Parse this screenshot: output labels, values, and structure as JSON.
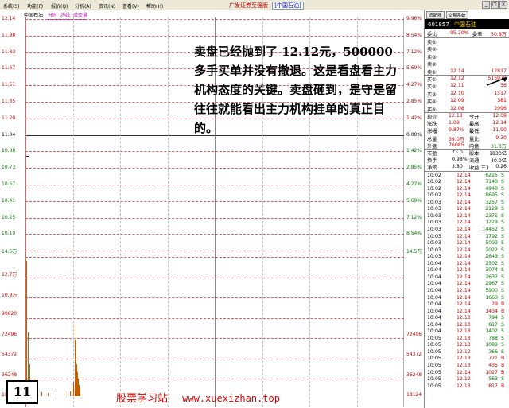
{
  "menubar": {
    "items": [
      "系统(S)",
      "功能(F)",
      "报价(Q)",
      "分析(A)",
      "资讯(N)",
      "查看(V)",
      "帮助(H)"
    ],
    "title": "广发证券至强版",
    "subtitle": "[中国石油]"
  },
  "chart": {
    "stock_name": "中国石油",
    "tab_time": "分时",
    "tab_avg": "均线",
    "tab_vol": "成交量",
    "price_labels": [
      "12.14",
      "11.98",
      "11.83",
      "11.67",
      "11.51",
      "11.35",
      "11.20",
      "11.04",
      "10.88",
      "10.73",
      "10.57",
      "10.41",
      "10.25",
      "10.10",
      "14.5万"
    ],
    "pct_labels": [
      "9.96%",
      "8.54%",
      "7.12%",
      "5.69%",
      "4.27%",
      "2.85%",
      "1.42%",
      "0.00%",
      "1.42%",
      "2.85%",
      "4.27%",
      "5.69%",
      "7.12%",
      "8.54%",
      "14.5万"
    ],
    "vol_labels": [
      "12.7万",
      "10.9万",
      "90620",
      "72496",
      "54372",
      "36248",
      "18124"
    ],
    "annotation": "卖盘已经抛到了 12.12元，500000 多手买单并没有撤退。这是看盘看主力机构态度的关键。卖盘砸到，是守是留往往就能看出主力机构挂单的真正目的。",
    "badge": "11",
    "watermark_text": "股票学习站",
    "watermark_url": "www.xuexizhan.top"
  },
  "panel": {
    "tab1": "适配器",
    "tab2": "交易系统",
    "code": "601857",
    "name": "中国石油",
    "ratio_label": "委比",
    "ratio": "95.20%",
    "diff_label": "委差",
    "diff": "50.8万",
    "sells": [
      {
        "label": "卖⑤",
        "price": "",
        "vol": ""
      },
      {
        "label": "卖④",
        "price": "",
        "vol": ""
      },
      {
        "label": "卖③",
        "price": "",
        "vol": ""
      },
      {
        "label": "卖②",
        "price": "",
        "vol": ""
      },
      {
        "label": "卖①",
        "price": "12.14",
        "vol": "12817"
      }
    ],
    "buys": [
      {
        "label": "买①",
        "price": "12.12",
        "vol": "515979"
      },
      {
        "label": "买②",
        "price": "12.11",
        "vol": "56"
      },
      {
        "label": "买③",
        "price": "12.10",
        "vol": "1517"
      },
      {
        "label": "买④",
        "price": "12.09",
        "vol": "381"
      },
      {
        "label": "买⑤",
        "price": "12.08",
        "vol": "2096"
      }
    ],
    "stats": [
      {
        "l1": "现价",
        "v1": "12.13",
        "l2": "今开",
        "v2": "12.08"
      },
      {
        "l1": "涨跌",
        "v1": "1.09",
        "l2": "最高",
        "v2": "12.14"
      },
      {
        "l1": "涨幅",
        "v1": "9.87%",
        "l2": "最低",
        "v2": "11.90"
      },
      {
        "l1": "总量",
        "v1": "39.0万",
        "l2": "量比",
        "v2": "9.30"
      },
      {
        "l1": "外盘",
        "v1": "76085",
        "l2": "内盘",
        "v2": "31.3万"
      }
    ],
    "stats2": [
      {
        "l1": "市盈",
        "v1": "23.0",
        "l2": "股本",
        "v2": "1830亿"
      },
      {
        "l1": "换手",
        "v1": "0.98%",
        "l2": "流通",
        "v2": "40.0亿"
      },
      {
        "l1": "净资",
        "v1": "3.80",
        "l2": "收益(三)",
        "v2": "0.26"
      }
    ],
    "ticks": [
      {
        "t": "10:02",
        "p": "12.14",
        "v": "6225",
        "s": "S"
      },
      {
        "t": "10:02",
        "p": "12.14",
        "v": "7140",
        "s": "S"
      },
      {
        "t": "10:02",
        "p": "12.14",
        "v": "4940",
        "s": "S"
      },
      {
        "t": "10:02",
        "p": "12.14",
        "v": "8695",
        "s": "S"
      },
      {
        "t": "10:03",
        "p": "12.14",
        "v": "3257",
        "s": "S"
      },
      {
        "t": "10:03",
        "p": "12.14",
        "v": "2129",
        "s": "S"
      },
      {
        "t": "10:03",
        "p": "12.14",
        "v": "2375",
        "s": "S"
      },
      {
        "t": "10:03",
        "p": "12.14",
        "v": "1229",
        "s": "S"
      },
      {
        "t": "10:03",
        "p": "12.14",
        "v": "14452",
        "s": "S"
      },
      {
        "t": "10:03",
        "p": "12.14",
        "v": "1792",
        "s": "S"
      },
      {
        "t": "10:03",
        "p": "12.14",
        "v": "5099",
        "s": "S"
      },
      {
        "t": "10:03",
        "p": "12.14",
        "v": "2022",
        "s": "S"
      },
      {
        "t": "10:03",
        "p": "12.14",
        "v": "2649",
        "s": "S"
      },
      {
        "t": "10:04",
        "p": "12.14",
        "v": "2502",
        "s": "S"
      },
      {
        "t": "10:04",
        "p": "12.14",
        "v": "3074",
        "s": "S"
      },
      {
        "t": "10:04",
        "p": "12.14",
        "v": "2632",
        "s": "S"
      },
      {
        "t": "10:04",
        "p": "12.14",
        "v": "2967",
        "s": "S"
      },
      {
        "t": "10:04",
        "p": "12.14",
        "v": "5900",
        "s": "S"
      },
      {
        "t": "10:04",
        "p": "12.14",
        "v": "1660",
        "s": "S"
      },
      {
        "t": "10:04",
        "p": "12.14",
        "v": "29",
        "s": "B"
      },
      {
        "t": "10:04",
        "p": "12.14",
        "v": "1434",
        "s": "B"
      },
      {
        "t": "10:04",
        "p": "12.13",
        "v": "794",
        "s": "S"
      },
      {
        "t": "10:04",
        "p": "12.13",
        "v": "817",
        "s": "S"
      },
      {
        "t": "10:04",
        "p": "12.13",
        "v": "1402",
        "s": "S"
      },
      {
        "t": "10:05",
        "p": "12.13",
        "v": "788",
        "s": "S"
      },
      {
        "t": "10:05",
        "p": "12.13",
        "v": "1089",
        "s": "S"
      },
      {
        "t": "10:05",
        "p": "12.12",
        "v": "366",
        "s": "S"
      },
      {
        "t": "10:05",
        "p": "12.13",
        "v": "771",
        "s": "B"
      },
      {
        "t": "10:05",
        "p": "12.13",
        "v": "435",
        "s": "B"
      },
      {
        "t": "10:05",
        "p": "12.14",
        "v": "1027",
        "s": "B"
      },
      {
        "t": "10:05",
        "p": "12.12",
        "v": "563",
        "s": "S"
      },
      {
        "t": "10:05",
        "p": "12.13",
        "v": "817",
        "s": "B"
      }
    ]
  },
  "colors": {
    "up": "#d00000",
    "down": "#008000",
    "volume": "#c06000",
    "watermark": "#d40000"
  }
}
